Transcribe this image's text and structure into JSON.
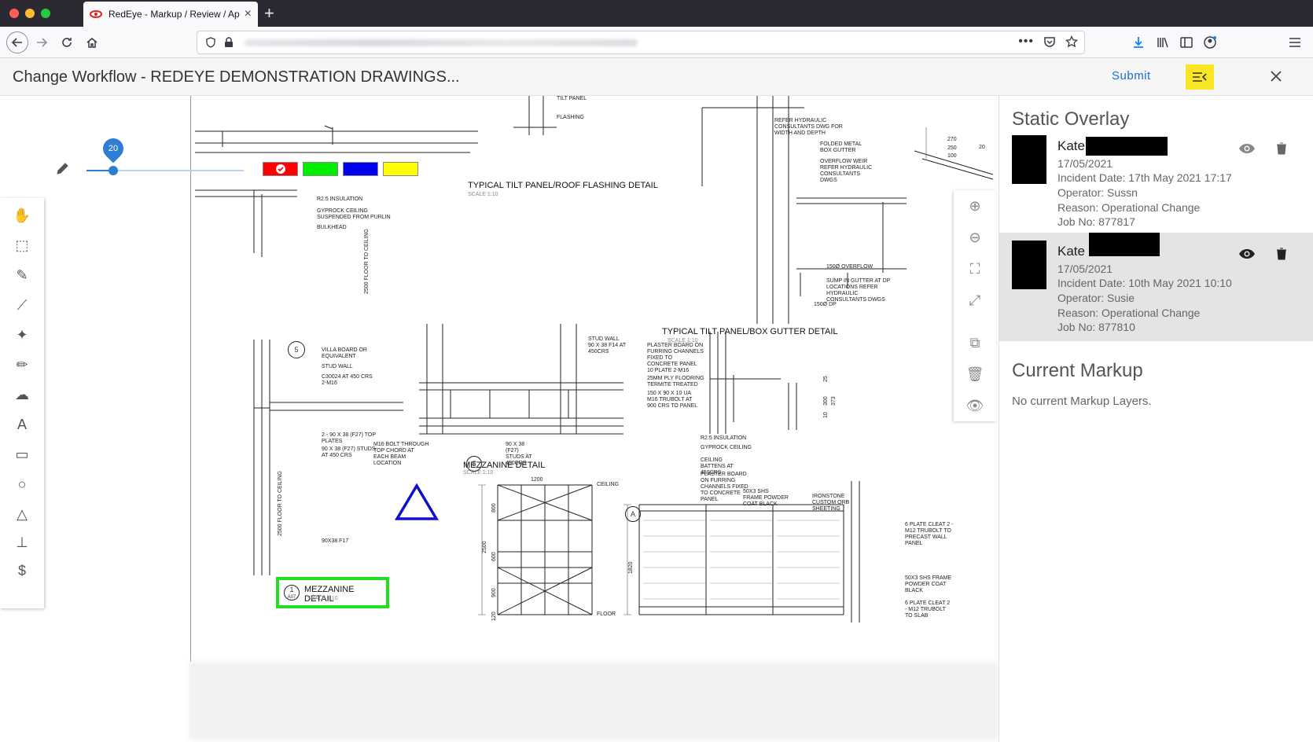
{
  "browser": {
    "tab_title": "RedEye - Markup / Review / App",
    "icons": {
      "back": "back-arrow-icon",
      "forward": "forward-arrow-icon",
      "reload": "reload-icon",
      "home": "home-icon",
      "shield": "shield-icon",
      "lock": "lock-icon",
      "more": "more-dots-icon",
      "pocket": "pocket-icon",
      "bookmark": "star-icon",
      "downloads": "download-icon",
      "library": "library-icon",
      "sidebar": "sidebar-icon",
      "account": "account-icon",
      "menu": "hamburger-menu-icon"
    }
  },
  "header": {
    "title": "Change Workflow - REDEYE DEMONSTRATION DRAWINGS...",
    "submit_label": "Submit"
  },
  "pen": {
    "size": "20",
    "size_fraction": 0.17,
    "colors": [
      "#ff0000",
      "#00ee00",
      "#0000ee",
      "#ffff00"
    ],
    "selected_color": "#ff0000"
  },
  "drawing": {
    "titles": {
      "tilt_flashing": "TYPICAL TILT PANEL/ROOF FLASHING DETAIL",
      "box_gutter": "TYPICAL TILT PANEL/BOX GUTTER DETAIL",
      "mezz_a": "MEZZANINE DETAIL",
      "mezz_b": "MEZZANINE DETAIL",
      "scale": "SCALE 1:10"
    },
    "labels": {
      "tilt_panel": "TILT PANEL",
      "flashing": "FLASHING",
      "r25": "R2.5 INSULATION",
      "gyprock": "GYPROCK CEILING SUSPENDED FROM PURLIN",
      "bulkhead": "BULKHEAD",
      "refer_hyd": "REFER HYDRAULIC CONSULTANTS DWG FOR WIDTH AND DEPTH",
      "folded": "FOLDED METAL BOX GUTTER",
      "overflow_weir": "OVERFLOW WEIR REFER HYDRAULIC CONSULTANTS DWGS",
      "overflow": "150Ø OVERFLOW",
      "sump": "SUMP IN GUTTER AT DP LOCATIONS REFER HYDRAULIC CONSULTANTS DWGS",
      "dp": "150Ø DP",
      "villa": "VILLA BOARD OR EQUIVALENT",
      "stud_wall": "STUD WALL",
      "c30024": "C30024 AT 450 CRS 2-M16",
      "stud_wall2": "STUD WALL 90 x 38 F14 AT 450CRS",
      "plaster": "PLASTER BOARD ON FURRING CHANNELS FIXED TO CONCRETE PANEL",
      "plate": "10 PLATE 2-M16",
      "ply": "25mm PLY FLOORING TERMITE TREATED",
      "ua": "150 x 90 x 10 UA M16 TRUBOLT AT 900 CRS TO PANEL",
      "top_plates": "2 - 90 x 38 (F27) TOP PLATES",
      "studs": "90 x 38 (F27) STUDS AT 450 CRS",
      "m16": "M16 BOLT THROUGH TOP CHORD AT EACH BEAM LOCATION",
      "studs2": "90 x 38 (F27) STUDS AT 450CRS",
      "r25b": "R2.5 INSULATION",
      "gyp_ceiling": "GYPROCK CEILING",
      "battens": "CEILING BATTENS AT 450CRS",
      "plaster2": "PLASTER BOARD ON FURRING CHANNELS FIXED TO CONCRETE PANEL",
      "shs": "50x3 SHS FRAME POWDER COAT BLACK",
      "ironstone": "IRONSTONE CUSTOM ORB SHEETING",
      "cleat": "6 PLATE CLEAT 2 - M12 TRUBOLT TO PRECAST WALL PANEL",
      "shs2": "50x3 SHS FRAME POWDER COAT BLACK",
      "cleat2": "6 PLATE CLEAT 2 - M12 TRUBOLT TO SLAB",
      "f17": "90x38 F17",
      "floor_ceiling": "2500 FLOOR TO CEILING",
      "floor_ceiling2": "2500 FLOOR TO CEILING",
      "ceiling": "CEILING",
      "floor": "FLOOR",
      "d1200": "1200",
      "d2500": "2500",
      "d800": "800",
      "d600": "600",
      "d900": "900",
      "d120": "120",
      "d1820": "1820",
      "d270": "270",
      "d250": "250",
      "d100": "100",
      "d20": "20",
      "d25": "25",
      "d300": "300",
      "d373": "373",
      "d10": "10",
      "ref5": "5",
      "ref5b": "5",
      "ref1": "1",
      "a07": "A07",
      "refA": "A"
    }
  },
  "left_tools": [
    {
      "name": "pan-hand-icon",
      "glyph": "✋"
    },
    {
      "name": "select-rect-icon",
      "glyph": "⬚"
    },
    {
      "name": "pencil-icon",
      "glyph": "✎"
    },
    {
      "name": "line-icon",
      "glyph": "⟋"
    },
    {
      "name": "magic-wand-icon",
      "glyph": "✦"
    },
    {
      "name": "highlighter-icon",
      "glyph": "✏"
    },
    {
      "name": "cloud-icon",
      "glyph": "☁"
    },
    {
      "name": "text-icon",
      "glyph": "A"
    },
    {
      "name": "rectangle-icon",
      "glyph": "▭"
    },
    {
      "name": "circle-icon",
      "glyph": "○"
    },
    {
      "name": "triangle-icon",
      "glyph": "△"
    },
    {
      "name": "stamp-icon",
      "glyph": "⊥"
    },
    {
      "name": "dollar-icon",
      "glyph": "$"
    }
  ],
  "right_tools": [
    {
      "name": "zoom-in-icon",
      "glyph": "⊕"
    },
    {
      "name": "zoom-out-icon",
      "glyph": "⊖"
    },
    {
      "name": "fit-to-screen-icon",
      "glyph": "⛶"
    },
    {
      "name": "expand-icon",
      "glyph": "⤢"
    },
    {
      "name": "copy-icon",
      "glyph": "⧉"
    },
    {
      "name": "trash-icon",
      "glyph": "🗑"
    },
    {
      "name": "eye-icon",
      "glyph": "👁"
    }
  ],
  "panel": {
    "static_title": "Static Overlay",
    "current_title": "Current Markup",
    "empty_message": "No current Markup Layers.",
    "overlays": [
      {
        "name": "Kate",
        "date": "17/05/2021",
        "incident": "Incident Date: 17th May 2021 17:17",
        "operator": "Operator: Sussn",
        "reason": "Reason: Operational Change",
        "job": "Job No: 877817"
      },
      {
        "name": "Kate",
        "date": "17/05/2021",
        "incident": "Incident Date: 10th May 2021 10:10",
        "operator": "Operator: Susie",
        "reason": "Reason: Operational Change",
        "job": "Job No: 877810"
      }
    ]
  }
}
